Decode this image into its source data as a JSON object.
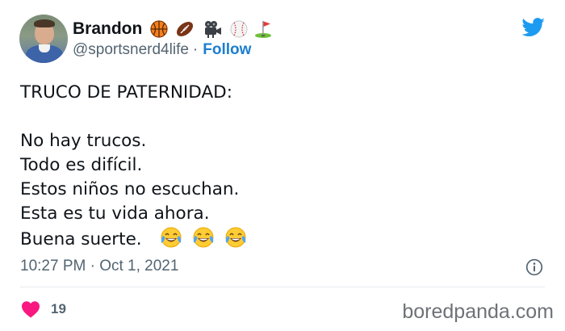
{
  "author": {
    "name": "Brandon",
    "handle": "@sportsnerd4life",
    "follow_label": "Follow",
    "separator": "·",
    "name_emojis": [
      "basketball-icon",
      "american-football-icon",
      "movie-camera-icon",
      "baseball-icon",
      "golf-flag-icon"
    ]
  },
  "tweet": {
    "lines": [
      "TRUCO DE PATERNIDAD:",
      "No hay trucos.",
      "Todo es difícil.",
      "Estos niños no escuchan.",
      "Esta es tu vida ahora.",
      "Buena suerte."
    ],
    "trailing_emojis": [
      "face-with-tears-of-joy-icon",
      "face-with-tears-of-joy-icon",
      "face-with-tears-of-joy-icon"
    ],
    "timestamp": "10:27 PM · Oct 1, 2021"
  },
  "engagement": {
    "likes": "19"
  },
  "watermark": "boredpanda.com",
  "colors": {
    "twitter_blue": "#1d9bf0",
    "follow_blue": "#1d7ecf",
    "heart_pink": "#f91880",
    "secondary_text": "#536471"
  }
}
